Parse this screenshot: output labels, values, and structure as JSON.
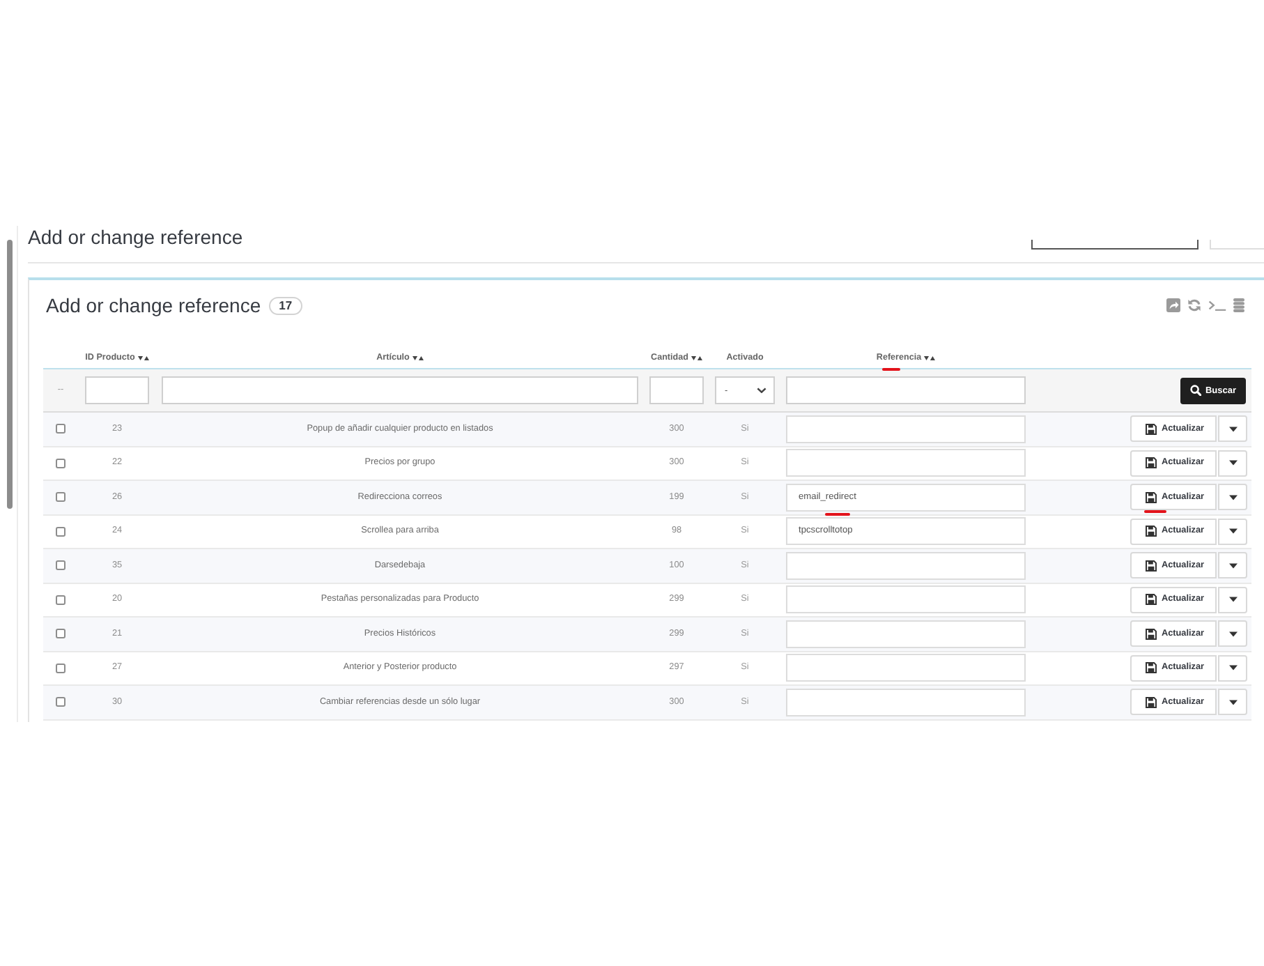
{
  "page_header": {
    "title": "Add or change reference"
  },
  "panel": {
    "title": "Add or change reference",
    "count": "17"
  },
  "table": {
    "columns": [
      {
        "label": "ID Producto",
        "sortable": true,
        "annotated": false
      },
      {
        "label": "Artículo",
        "sortable": true,
        "annotated": false
      },
      {
        "label": "Cantidad",
        "sortable": true,
        "annotated": false
      },
      {
        "label": "Activado",
        "sortable": false,
        "annotated": false
      },
      {
        "label": "Referencia",
        "sortable": true,
        "annotated": true
      }
    ],
    "filters": {
      "reset": "--",
      "activated": "-",
      "button": "Buscar"
    },
    "rows": [
      {
        "checked": false,
        "id": "23",
        "article": "Popup de añadir cualquier producto en listados",
        "quantity": "300",
        "active": "Si",
        "button": "Actualizar",
        "annotated": false
      },
      {
        "checked": false,
        "id": "22",
        "article": "Precios por grupo",
        "quantity": "300",
        "active": "Si",
        "button": "Actualizar",
        "annotated": false
      },
      {
        "checked": false,
        "id": "26",
        "article": "Redirecciona correos",
        "quantity": "199",
        "active": "Si",
        "reference": "email_redirect",
        "button": "Actualizar",
        "annotated": true
      },
      {
        "checked": false,
        "id": "24",
        "article": "Scrollea para arriba",
        "quantity": "98",
        "active": "Si",
        "reference": "tpcscrolltotop",
        "button": "Actualizar",
        "annotated": false
      },
      {
        "checked": false,
        "id": "35",
        "article": "Darsedebaja",
        "quantity": "100",
        "active": "Si",
        "button": "Actualizar",
        "annotated": false
      },
      {
        "checked": false,
        "id": "20",
        "article": "Pestañas personalizadas para Producto",
        "quantity": "299",
        "active": "Si",
        "button": "Actualizar",
        "annotated": false
      },
      {
        "checked": false,
        "id": "21",
        "article": "Precios Históricos",
        "quantity": "299",
        "active": "Si",
        "button": "Actualizar",
        "annotated": false
      },
      {
        "checked": false,
        "id": "27",
        "article": "Anterior y Posterior producto",
        "quantity": "297",
        "active": "Si",
        "button": "Actualizar",
        "annotated": false
      },
      {
        "checked": false,
        "id": "30",
        "article": "Cambiar referencias desde un sólo lugar",
        "quantity": "300",
        "active": "Si",
        "button": "Actualizar",
        "annotated": false
      }
    ]
  }
}
